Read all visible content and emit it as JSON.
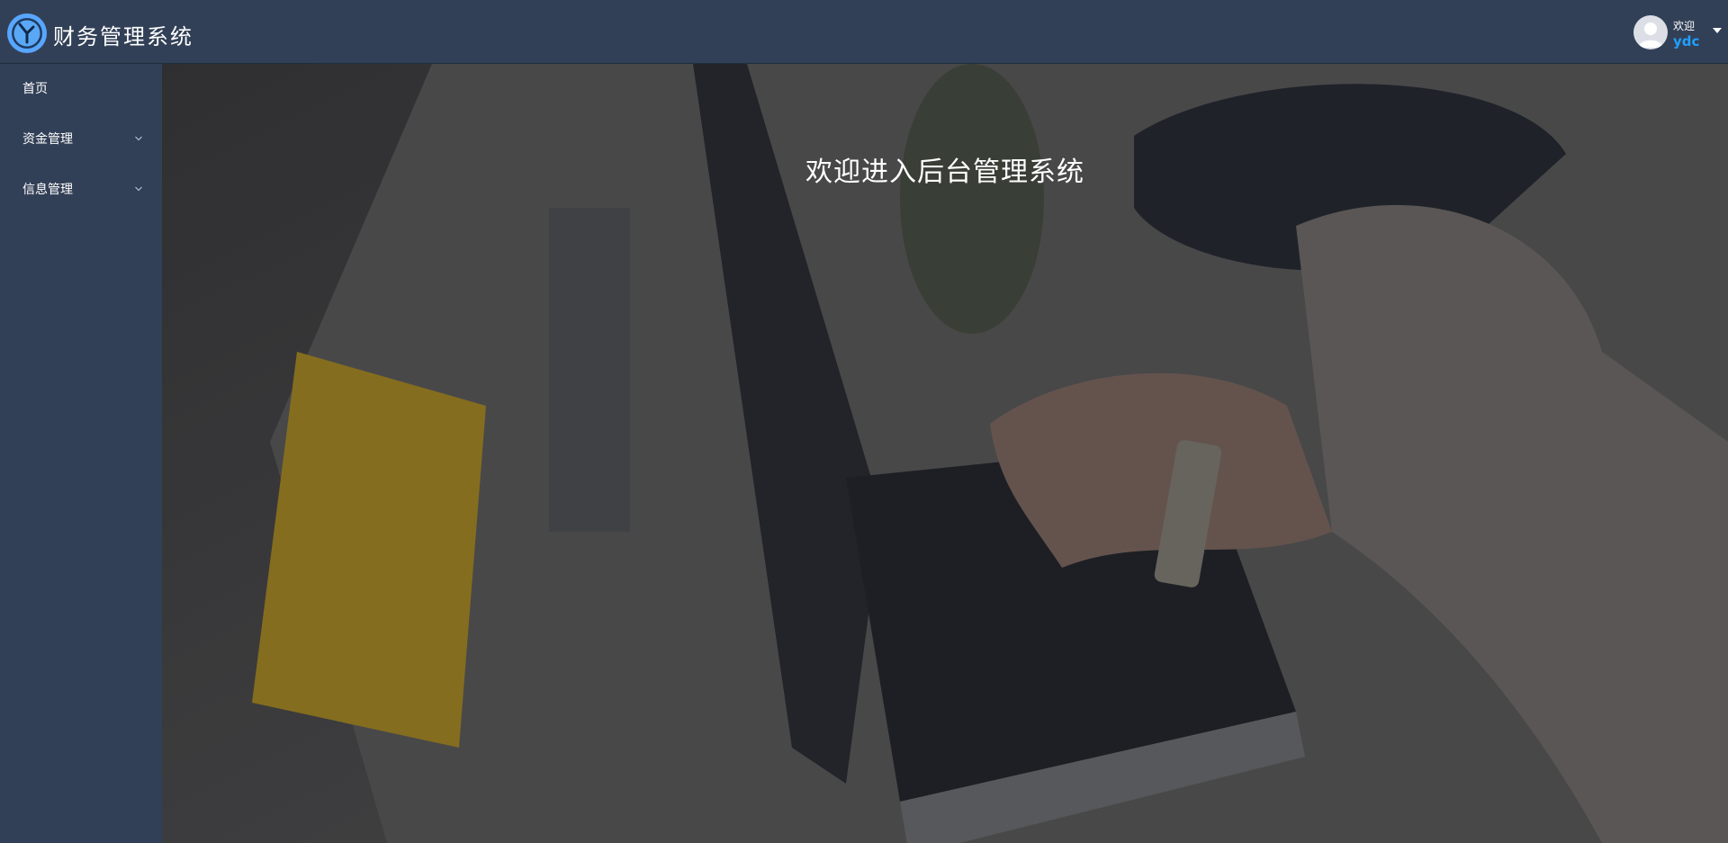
{
  "header": {
    "app_title": "财务管理系统",
    "logo_icon": "clock-logo-icon",
    "user": {
      "welcome": "欢迎",
      "name": "ydc",
      "avatar_icon": "user-avatar-icon",
      "dropdown_icon": "caret-down-icon"
    }
  },
  "sidebar": {
    "items": [
      {
        "label": "首页",
        "has_submenu": false
      },
      {
        "label": "资金管理",
        "has_submenu": true
      },
      {
        "label": "信息管理",
        "has_submenu": true
      }
    ]
  },
  "main": {
    "heading": "欢迎进入后台管理系统"
  },
  "colors": {
    "nav_bg": "#324057",
    "accent": "#20a0ff"
  }
}
